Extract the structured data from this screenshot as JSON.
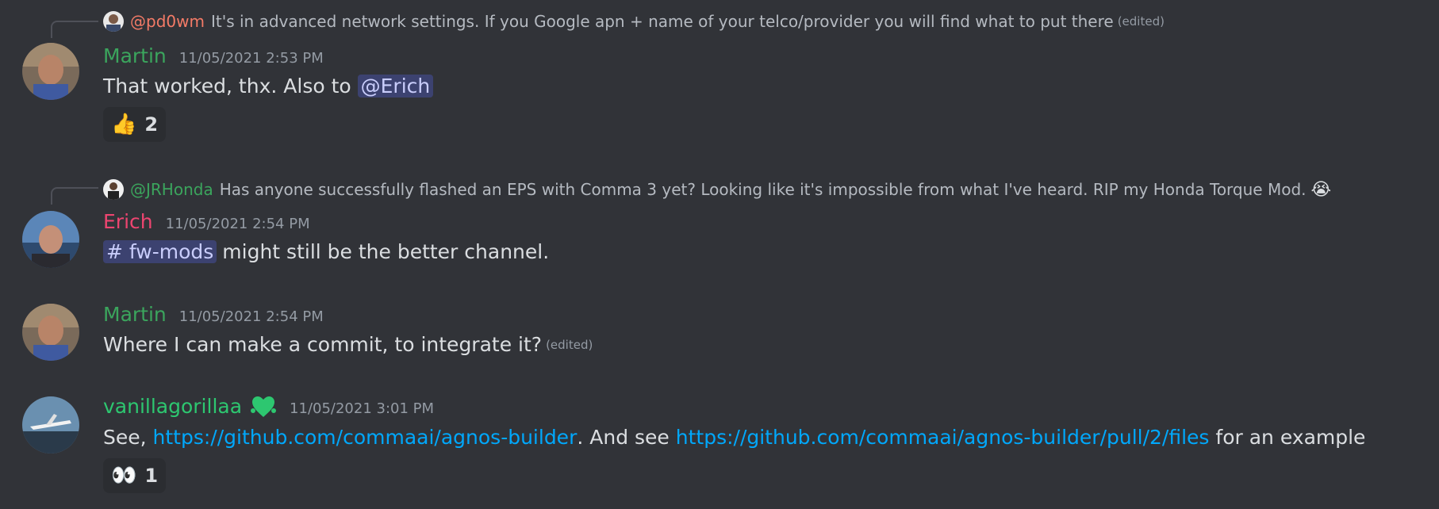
{
  "messages": [
    {
      "reply_to": {
        "mention": "@pd0wm",
        "mention_color": "#f47b67",
        "text": "It's in advanced network settings. If you Google apn + name of your telco/provider you will find what to put there",
        "edited": "(edited)"
      },
      "author": "Martin",
      "author_color": "#3ba55d",
      "timestamp": "11/05/2021 2:53 PM",
      "content_text": "That worked, thx. Also to ",
      "content_mention": "@Erich",
      "reaction": {
        "emoji": "👍",
        "count": "2"
      }
    },
    {
      "reply_to": {
        "mention": "@JRHonda",
        "mention_color": "#3ba55d",
        "text": "Has anyone successfully flashed an EPS with Comma 3 yet? Looking like it's impossible from what I've heard. RIP my Honda Torque Mod.",
        "emoji": "😭"
      },
      "author": "Erich",
      "author_color": "#ed4570",
      "timestamp": "11/05/2021 2:54 PM",
      "channel_name": "fw-mods",
      "content_text": "might still be the better channel."
    },
    {
      "author": "Martin",
      "author_color": "#3ba55d",
      "timestamp": "11/05/2021 2:54 PM",
      "content_text": "Where I can make a commit, to integrate it?",
      "edited": "(edited)"
    },
    {
      "author": "vanillagorillaa",
      "author_color": "#2dc770",
      "badge_icon": "nitro-boost-heart-icon",
      "timestamp": "11/05/2021 3:01 PM",
      "content_prefix": "See, ",
      "link1": "https://github.com/commaai/agnos-builder",
      "content_mid": ". And see ",
      "link2": "https://github.com/commaai/agnos-builder/pull/2/files",
      "content_suffix": " for an example",
      "reaction": {
        "emoji": "👀",
        "count": "1"
      }
    }
  ]
}
